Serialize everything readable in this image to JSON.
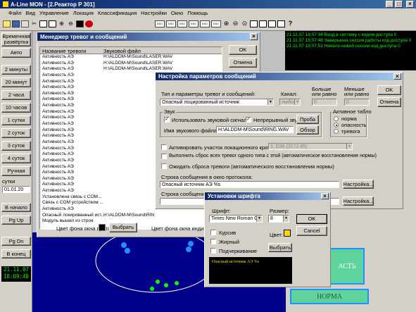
{
  "app": {
    "title": "A-Line MON - [2.Реактор Р 301]",
    "menu": [
      "Файл",
      "Вид",
      "Управление",
      "Локация",
      "Классификация",
      "Настройки",
      "Окно",
      "Помощь"
    ]
  },
  "sidebar": {
    "buttons": [
      "Временная развёртка",
      "Авто",
      "2 минуты",
      "20 минут",
      "2 часа",
      "10 часов",
      "1 сутки",
      "2 суток",
      "3 суток",
      "4 суток",
      "Ручная"
    ],
    "from_label": "сутки",
    "from_date": "01.01.20",
    "nav": [
      "В начало",
      "Pg Up",
      "Pg Dn",
      "В конец"
    ],
    "date": "21.11.07",
    "time": "18:09:48"
  },
  "log": [
    "21.11.07 18:07:34 Вход в систему с кодом доступа 0",
    "21.11.07 18:07:48 Завершена сессия работы код доступа 0",
    "21.11.07 18:07:51 Начало новой сессии код доступа 0"
  ],
  "alarm_manager": {
    "title": "Менеджер тревог и сообщений",
    "col_name": "Название тревоги",
    "col_file": "Звуковой файл",
    "rows": [
      {
        "name": "Активность АЭ",
        "file": "H:\\ALDDM-M\\Sound\\LASER.WAV"
      },
      {
        "name": "Активность АЭ",
        "file": "H:\\ALDDM-M\\Sound\\LASER.WAV"
      },
      {
        "name": "Активность АЭ",
        "file": "H:\\ALDDM-M\\Sound\\LASER.WAV"
      },
      {
        "name": "Активность АЭ",
        "file": ""
      },
      {
        "name": "Активность АЭ",
        "file": ""
      },
      {
        "name": "Активность АЭ",
        "file": ""
      },
      {
        "name": "Активность АЭ",
        "file": ""
      },
      {
        "name": "Активность АЭ",
        "file": ""
      },
      {
        "name": "Активность АЭ",
        "file": ""
      },
      {
        "name": "Активность АЭ",
        "file": ""
      },
      {
        "name": "Активность АЭ",
        "file": ""
      },
      {
        "name": "Активность АЭ",
        "file": ""
      },
      {
        "name": "Активность АЭ",
        "file": ""
      },
      {
        "name": "Активность АЭ",
        "file": ""
      },
      {
        "name": "Активность АЭ",
        "file": ""
      },
      {
        "name": "Активность АЭ",
        "file": ""
      },
      {
        "name": "Активность АЭ",
        "file": ""
      },
      {
        "name": "Активность АЭ",
        "file": ""
      },
      {
        "name": "Активность АЭ",
        "file": ""
      },
      {
        "name": "Активность АЭ",
        "file": ""
      },
      {
        "name": "Активность АЭ",
        "file": ""
      },
      {
        "name": "Активность АЭ",
        "file": ""
      },
      {
        "name": "Активность АЭ",
        "file": ""
      },
      {
        "name": "Установлена связь с COM...",
        "file": ""
      },
      {
        "name": "Связь с COM устройством ...",
        "file": ""
      },
      {
        "name": "Активность АЭ",
        "file": ""
      },
      {
        "name": "Опасный локированный ист...",
        "file": "H:\\ALDDM-M\\Sound\\RIN"
      },
      {
        "name": "Модуль вышел из строя",
        "file": ""
      }
    ],
    "ok": "OK",
    "cancel": "Отмена",
    "protocol_bg_label": "Цвет фона окна протокола:",
    "select": "Выбрать",
    "indicator_bg_label": "Цвет фона окна индикато"
  },
  "msg_settings": {
    "title": "Настройка параметров сообщений",
    "type_label": "Тип и параметры тревог и сообщений:",
    "type_value": "Опасный лоцированный источник",
    "channel_label": "Канал:",
    "channel_value": "любой",
    "more_label": "Больше или равно",
    "more_value": "0",
    "less_label": "Меньше или равно",
    "less_value": "0",
    "ok": "OK",
    "cancel": "Отмена",
    "sound_group": "Звук",
    "use_sound": "Использовать звуковой сигнал",
    "cont_sound": "Непрерывный звук",
    "test": "Проба",
    "sound_file_label": "Имя звукового файла:",
    "sound_file": "H:\\ALDDM-M\\Sound\\RING.WAV",
    "browse": "Обзор",
    "active_group": "Активное табло",
    "radio_norm": "норма",
    "radio_danger": "опасность",
    "radio_alarm": "тревога",
    "activate_loc": "Активировать участок локационного критерия:",
    "activate_loc_value": "1: D30 (3172.95)",
    "reset_line": "Выполнить сброс всех тревог одного типа с этой (автоматическое восстановление нормы)",
    "wait_reset": "Ожидать сброса тревоги (автоматического восстановления нормы)",
    "protocol_line_label": "Строка сообщения в окно протокола:",
    "protocol_line": "Опасный источник АЭ %s",
    "settings": "Настройка...",
    "second_line_label": "Строка сообщения в",
    "settings2": "Настройка..."
  },
  "font_dialog": {
    "title": "Установки шрифта",
    "font_label": "Шрифт:",
    "font_value": "Times New Roman Cy",
    "size_label": "Размер:",
    "size_value": "8",
    "ok": "OK",
    "cancel": "Cancel",
    "italic": "Курсив",
    "bold": "Жирный",
    "underline": "Подчеркивание",
    "color_label": "Цвет:",
    "color": "#ffd700",
    "select": "Выбрать",
    "preview": "Опасный источник АЭ %s"
  },
  "indicators": {
    "norm": "НОРМА",
    "partial": "АСТЬ"
  },
  "colors": {
    "accent": "#0a246a",
    "log_green": "#00ff00",
    "norm_green": "#5fd39c",
    "indicator_blue": "#1e90ff"
  }
}
